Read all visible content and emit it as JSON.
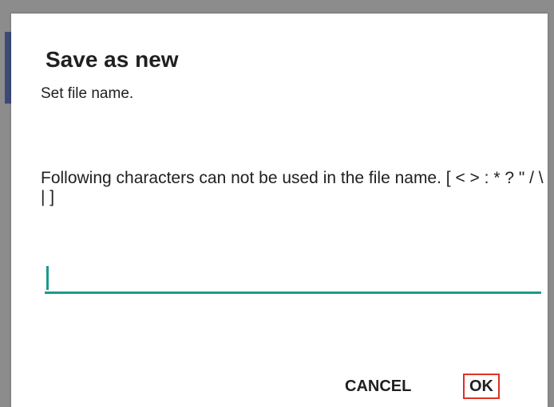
{
  "dialog": {
    "title": "Save as new",
    "subtitle": "Set file name.",
    "warning": "Following characters can not be used in the file name. [ < > : * ? \" / \\ | ]",
    "filename_input": {
      "value": "",
      "placeholder": ""
    },
    "buttons": {
      "cancel_label": "CANCEL",
      "ok_label": "OK"
    }
  },
  "colors": {
    "accent": "#1a9a8a",
    "highlight_border": "#e03020",
    "text": "#202020",
    "backdrop": "#8c8c8c"
  }
}
